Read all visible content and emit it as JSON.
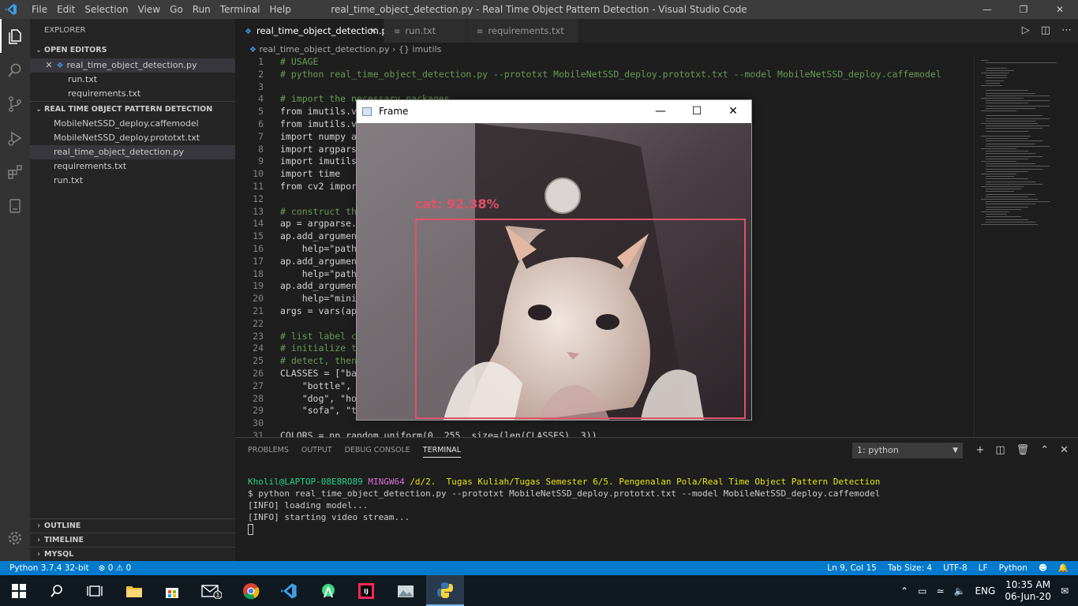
{
  "window": {
    "title": "real_time_object_detection.py - Real Time Object Pattern Detection - Visual Studio Code",
    "menu": [
      "File",
      "Edit",
      "Selection",
      "View",
      "Go",
      "Run",
      "Terminal",
      "Help"
    ]
  },
  "sidebar": {
    "title": "EXPLORER",
    "open_editors_label": "OPEN EDITORS",
    "open_editors": [
      "real_time_object_detection.py",
      "run.txt",
      "requirements.txt"
    ],
    "project_label": "REAL TIME OBJECT PATTERN DETECTION",
    "files": [
      "MobileNetSSD_deploy.caffemodel",
      "MobileNetSSD_deploy.prototxt.txt",
      "real_time_object_detection.py",
      "requirements.txt",
      "run.txt"
    ],
    "outline": "OUTLINE",
    "timeline": "TIMELINE",
    "mysql": "MYSQL"
  },
  "tabs": [
    "real_time_object_detection.py",
    "run.txt",
    "requirements.txt"
  ],
  "breadcrumb": {
    "file": "real_time_object_detection.py",
    "symbol": "{} imutils"
  },
  "code_lines": [
    {
      "n": "1",
      "t": "# USAGE"
    },
    {
      "n": "2",
      "t": "# python real_time_object_detection.py --prototxt MobileNetSSD_deploy.prototxt.txt --model MobileNetSSD_deploy.caffemodel"
    },
    {
      "n": "3",
      "t": ""
    },
    {
      "n": "4",
      "t": "# import the necessary packages"
    },
    {
      "n": "5",
      "t": "from imutils.vi"
    },
    {
      "n": "6",
      "t": "from imutils.vi"
    },
    {
      "n": "7",
      "t": "import numpy as"
    },
    {
      "n": "8",
      "t": "import argparse"
    },
    {
      "n": "9",
      "t": "import imutils"
    },
    {
      "n": "10",
      "t": "import time"
    },
    {
      "n": "11",
      "t": "from cv2 import"
    },
    {
      "n": "12",
      "t": ""
    },
    {
      "n": "13",
      "t": "# construct the"
    },
    {
      "n": "14",
      "t": "ap = argparse.A"
    },
    {
      "n": "15",
      "t": "ap.add_argument"
    },
    {
      "n": "16",
      "t": "    help=\"path"
    },
    {
      "n": "17",
      "t": "ap.add_argument"
    },
    {
      "n": "18",
      "t": "    help=\"path"
    },
    {
      "n": "19",
      "t": "ap.add_argument"
    },
    {
      "n": "20",
      "t": "    help=\"minim"
    },
    {
      "n": "21",
      "t": "args = vars(ap."
    },
    {
      "n": "22",
      "t": ""
    },
    {
      "n": "23",
      "t": "# list label cl"
    },
    {
      "n": "24",
      "t": "# initialize th"
    },
    {
      "n": "25",
      "t": "# detect, then"
    },
    {
      "n": "26",
      "t": "CLASSES = [\"bac"
    },
    {
      "n": "27",
      "t": "    \"bottle\", \""
    },
    {
      "n": "28",
      "t": "    \"dog\", \"hor"
    },
    {
      "n": "29",
      "t": "    \"sofa\", \"tr"
    },
    {
      "n": "30",
      "t": ""
    },
    {
      "n": "31",
      "t": "COLORS = np.random.uniform(0, 255, size=(len(CLASSES), 3))"
    }
  ],
  "panel": {
    "tabs": [
      "PROBLEMS",
      "OUTPUT",
      "DEBUG CONSOLE",
      "TERMINAL"
    ],
    "terminal_select": "1: python",
    "prompt_user": "Kholil@LAPTOP-08E8RO89",
    "prompt_env": "MINGW64",
    "prompt_path": "/d/2.  Tugas Kuliah/Tugas Semester 6/5. Pengenalan Pola/Real Time Object Pattern Detection",
    "command": "$ python real_time_object_detection.py --prototxt MobileNetSSD_deploy.prototxt.txt --model MobileNetSSD_deploy.caffemodel",
    "output1": "[INFO] loading model...",
    "output2": "[INFO] starting video stream..."
  },
  "frame_window": {
    "title": "Frame",
    "detection_label": "cat: 92.38%"
  },
  "statusbar": {
    "interpreter": "Python 3.7.4 32-bit",
    "errors": "0",
    "warnings": "0",
    "position": "Ln 9, Col 15",
    "tab_size": "Tab Size: 4",
    "encoding": "UTF-8",
    "eol": "LF",
    "language": "Python"
  },
  "taskbar": {
    "lang": "ENG",
    "time": "10:35 AM",
    "date": "06-Jun-20",
    "notification_count": "1"
  },
  "colors": {
    "accent": "#007acc",
    "detection_box": "#e0526b"
  }
}
